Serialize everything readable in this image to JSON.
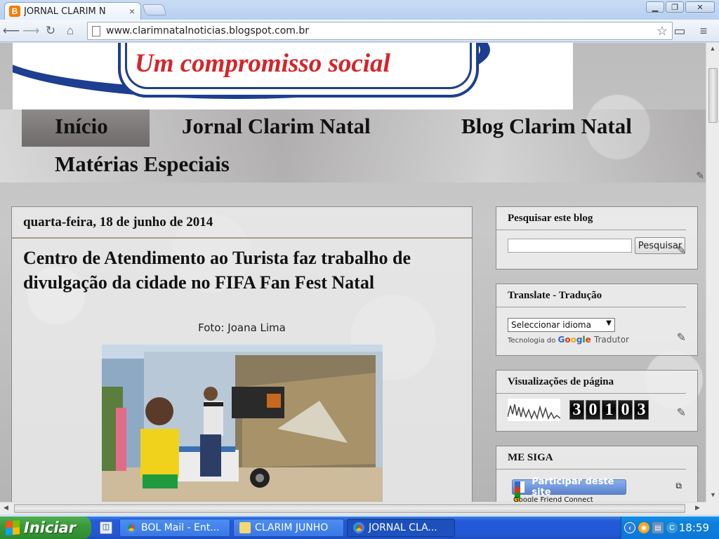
{
  "browser": {
    "tab_title": "JORNAL CLARIM N",
    "tab_close": "×",
    "url": "www.clarimnatalnoticias.blogspot.com.br",
    "favicon_letter": "B",
    "icons": [
      "back-icon",
      "forward-icon",
      "reload-icon",
      "home-icon",
      "bookmark-star-icon",
      "window-icon",
      "menu-icon"
    ]
  },
  "banner": {
    "slogan": "Um compromisso social",
    "brand_colors": {
      "blue": "#1e3e8f",
      "red": "#d4252a"
    }
  },
  "menu": {
    "items": [
      "Início",
      "Jornal Clarim Natal",
      "Blog Clarim Natal",
      "Matérias Especiais"
    ],
    "active_index": 0
  },
  "post": {
    "date": "quarta-feira, 18 de junho de 2014",
    "title": "Centro de Atendimento ao Turista faz trabalho de divulgação da cidade no FIFA Fan Fest Natal",
    "caption": "Foto: Joana Lima"
  },
  "sidebar": {
    "search": {
      "title": "Pesquisar este blog",
      "button": "Pesquisar",
      "value": ""
    },
    "translate": {
      "title": "Translate - Tradução",
      "select_value": "Seleccionar idioma",
      "powered_prefix": "Tecnologia do",
      "powered_brand": "Google",
      "powered_suffix": "Tradutor"
    },
    "pageviews": {
      "title": "Visualizações de página",
      "digits": [
        "3",
        "0",
        "1",
        "0",
        "3"
      ]
    },
    "follow": {
      "title": "ME SIGA",
      "button": "Participar deste site",
      "subtext": "Google Friend Connect"
    }
  },
  "taskbar": {
    "start": "Iniciar",
    "tasks": [
      {
        "label": "BOL Mail - Ent...",
        "active": false
      },
      {
        "label": "CLARIM JUNHO",
        "active": false
      },
      {
        "label": "JORNAL CLA...",
        "active": true
      }
    ],
    "clock": "18:59"
  }
}
